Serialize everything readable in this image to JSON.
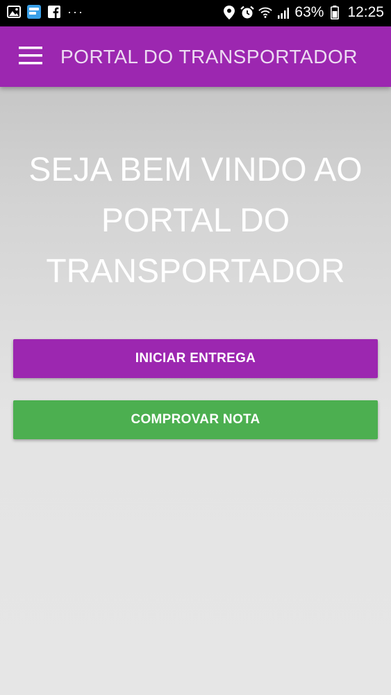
{
  "status_bar": {
    "icons_left": [
      "gallery-icon",
      "wordbit-icon",
      "facebook-icon"
    ],
    "more_notifications": "···",
    "battery_percent": "63%",
    "time": "12:25"
  },
  "app_bar": {
    "title": "PORTAL DO TRANSPORTADOR",
    "menu_icon": "hamburger-menu-icon"
  },
  "main": {
    "welcome_lines": [
      "SEJA BEM VINDO AO",
      "PORTAL DO",
      "TRANSPORTADOR"
    ],
    "start_delivery_label": "INICIAR ENTREGA",
    "proof_note_label": "COMPROVAR NOTA"
  },
  "colors": {
    "primary": "#9c27b0",
    "success": "#4caf50",
    "background": "#e6e6e6"
  }
}
